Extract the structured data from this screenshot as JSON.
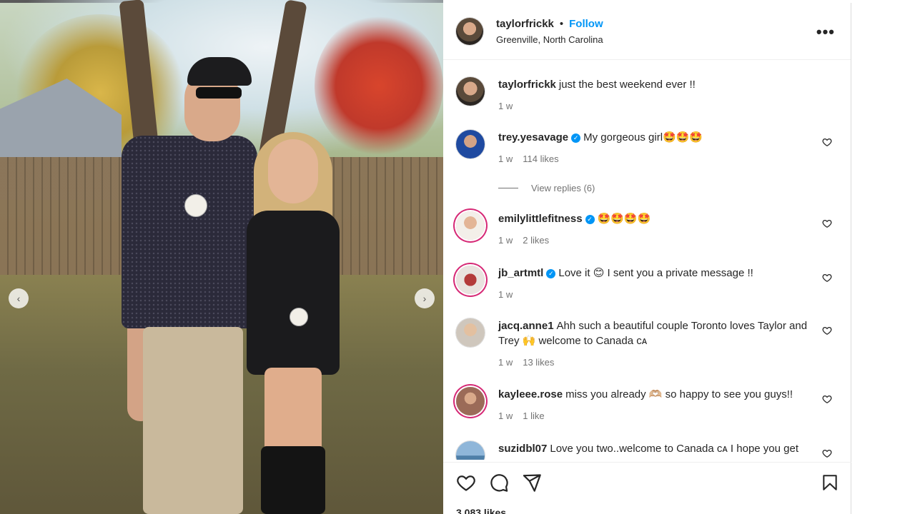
{
  "post": {
    "username": "taylorfrickk",
    "follow_label": "Follow",
    "separator": "•",
    "location": "Greenville, North Carolina",
    "more_label": "•••"
  },
  "carousel": {
    "prev_icon": "chevron-left-icon",
    "next_icon": "chevron-right-icon",
    "prev_glyph": "‹",
    "next_glyph": "›"
  },
  "comments": [
    {
      "user": "taylorfrickk",
      "verified": false,
      "text": "just the best weekend ever !!",
      "time": "1 w",
      "likes": ""
    },
    {
      "user": "trey.yesavage",
      "verified": true,
      "text": "My gorgeous girl🤩🤩🤩",
      "time": "1 w",
      "likes": "114 likes",
      "view_replies": "View replies (6)"
    },
    {
      "user": "emilylittlefitness",
      "verified": true,
      "text": "🤩🤩🤩🤩",
      "time": "1 w",
      "likes": "2 likes"
    },
    {
      "user": "jb_artmtl",
      "verified": true,
      "text": "Love it 😊 I sent you a private message !!",
      "time": "1 w",
      "likes": ""
    },
    {
      "user": "jacq.anne1",
      "verified": false,
      "text": "Ahh such a beautiful couple Toronto loves Taylor and Trey 🙌 welcome to Canada ᴄᴀ",
      "time": "1 w",
      "likes": "13 likes"
    },
    {
      "user": "kayleee.rose",
      "verified": false,
      "text": "miss you already 🫶🏼 so happy to see you guys!!",
      "time": "1 w",
      "likes": "1 like"
    },
    {
      "user": "suzidbl07",
      "verified": false,
      "text": "Love you two..welcome to Canada ᴄᴀ I hope you get",
      "time": "",
      "likes": ""
    }
  ],
  "actions": {
    "like_icon": "heart-icon",
    "comment_icon": "comment-icon",
    "share_icon": "send-icon",
    "save_icon": "bookmark-icon"
  },
  "likes_count": "3,083 likes",
  "colors": {
    "link": "#0095f6",
    "text": "#262626",
    "muted": "#737373",
    "story_ring": "#d62976"
  }
}
